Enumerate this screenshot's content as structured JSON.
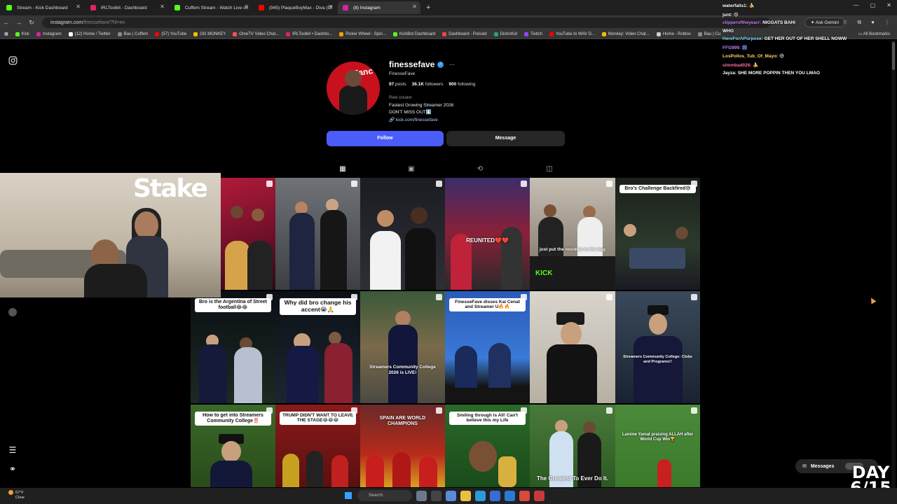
{
  "browser": {
    "tabs": [
      {
        "label": "Stream - Kick Dashboard",
        "color": "#53fc18",
        "active": false
      },
      {
        "label": "IRLToolkit - Dashboard",
        "color": "#e0245e",
        "active": false
      },
      {
        "label": "Cuffem Stream - Watch Live on",
        "color": "#53fc18",
        "active": false
      },
      {
        "label": "(945) PlaqueBoyMax - Diva (Of",
        "color": "#ff0000",
        "active": false
      },
      {
        "label": "(8) Instagram",
        "color": "#d6249f",
        "active": true
      }
    ],
    "url_host": "instagram.com",
    "url_path": "/finessefave/?hl=en",
    "ask_gemini": "Ask Gemini",
    "bookmarks": [
      {
        "label": "Kick",
        "color": "#53fc18"
      },
      {
        "label": "Instagram",
        "color": "#d6249f"
      },
      {
        "label": "(12) Home / Twitter",
        "color": "#ffffff"
      },
      {
        "label": "Bau | Cuffem",
        "color": "#888888"
      },
      {
        "label": "(57) YouTube",
        "color": "#ff0000"
      },
      {
        "label": "OG MONKEY",
        "color": "#f0c000"
      },
      {
        "label": "OmeTV Video Chat...",
        "color": "#ff5050"
      },
      {
        "label": "IRLToolkit • Dashbo...",
        "color": "#e0245e"
      },
      {
        "label": "Picker Wheel - Spin...",
        "color": "#f0a000"
      },
      {
        "label": "KickBot Dashboard",
        "color": "#53fc18"
      },
      {
        "label": "Dashboard - Pulsoid",
        "color": "#ff4040"
      },
      {
        "label": "DistroKid",
        "color": "#2a9d8f"
      },
      {
        "label": "Twitch",
        "color": "#9146ff"
      },
      {
        "label": "YouTube to WAV D...",
        "color": "#ff0000"
      },
      {
        "label": "Monkey: Video Chat...",
        "color": "#f0c000"
      },
      {
        "label": "Home - Roblox",
        "color": "#cccccc"
      },
      {
        "label": "Bau | Cu",
        "color": "#888888"
      }
    ],
    "all_bookmarks": "All Bookmarks"
  },
  "profile": {
    "username": "finessefave",
    "full_name": "FinesseFave",
    "posts_count": "97",
    "posts_label": "posts",
    "followers_count": "36.1K",
    "followers_label": "followers",
    "following_count": "900",
    "following_label": "following",
    "category": "Reel creator",
    "bio_line1": "Fastest Growing Streamer 2026",
    "bio_line2": "DON'T MISS OUT⬇️",
    "link": "kick.com/finessefave",
    "follow_label": "Follow",
    "message_label": "Message",
    "avatar_text": "Fanc"
  },
  "grid": {
    "captions": [
      {
        "text": "",
        "style": "none"
      },
      {
        "text": "",
        "style": "none"
      },
      {
        "text": "",
        "style": "none"
      },
      {
        "text": "REUNITED❤️❤️",
        "style": "plain"
      },
      {
        "text": "just put the noodles in the bag",
        "style": "plain"
      },
      {
        "text": "Bro's Challenge Backfired😅",
        "style": "box"
      },
      {
        "text": "Bro is the Argentina of Street football😂😂",
        "style": "box"
      },
      {
        "text": "Why did bro change his accent😭🙏",
        "style": "box"
      },
      {
        "text": "Streamers Community College 2026 is LIVE!",
        "style": "plain"
      },
      {
        "text": "FinesseFave disses Kai Cenat and Streamer U🔥🔥",
        "style": "box"
      },
      {
        "text": "",
        "style": "none"
      },
      {
        "text": "Streamers Community College: Clubs and Programs!!",
        "style": "plain"
      },
      {
        "text": "How to get into Streamers Community College‼️",
        "style": "box"
      },
      {
        "text": "TRUMP DIDN'T WANT TO LEAVE THE STAGE😂😂😂",
        "style": "box"
      },
      {
        "text": "SPAIN ARE WORLD CHAMPIONS",
        "style": "plain"
      },
      {
        "text": "Smiling through is All! Can't believe this my Life",
        "style": "box"
      },
      {
        "text": "The Greatest To Ever Do It.",
        "style": "plain"
      },
      {
        "text": "Lamine Yamal praising ALLAH after World Cup Win🏆",
        "style": "plain"
      }
    ],
    "kick_watermark": "KICK"
  },
  "overlay": {
    "stake_logo": "Stake",
    "chat": [
      {
        "user": "waterfalls1:",
        "msg": "🍌",
        "color": "#ffffff"
      },
      {
        "user": "junt:",
        "msg": "😄",
        "color": "#ffffff"
      },
      {
        "user": "clipperoftheyearr:",
        "msg": "NIGGATS BAHI",
        "color": "#c77dff"
      },
      {
        "user": "",
        "msg": "WHO",
        "color": "#ffffff"
      },
      {
        "user": "HereForAPurpose:",
        "msg": "GET HER OUT OF HER SHELL NOWW",
        "color": "#7fdfff"
      },
      {
        "user": "FFG999:",
        "msg": "🎆",
        "color": "#c77dff"
      },
      {
        "user": "LosPollos_Tub_Of_Mayo:",
        "msg": "😅",
        "color": "#ffd166"
      },
      {
        "user": "simmbad026:",
        "msg": "🍌",
        "color": "#ff6b9d"
      },
      {
        "user": "Jayza:",
        "msg": "SHE MORE POPPIN THEN YOU LMAO",
        "color": "#ffffff"
      }
    ],
    "day_word": "DAY",
    "day_count": "6/15"
  },
  "messages_label": "Messages",
  "taskbar": {
    "temp": "67°F",
    "weather": "Clear",
    "search_placeholder": "Search"
  }
}
